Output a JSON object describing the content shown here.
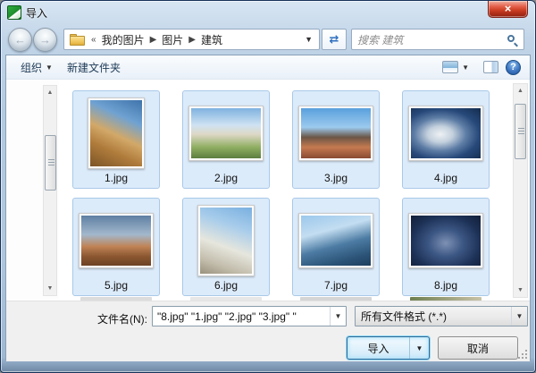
{
  "window": {
    "title": "导入"
  },
  "colors": {
    "selection_fill": "#dcebfa",
    "selection_border": "#a9c8e8",
    "close_button": "#c93b22",
    "default_button_glow": "#8fd8f4"
  },
  "icons": {
    "close": "×",
    "back": "←",
    "forward": "→",
    "refresh": "⇄",
    "dropdown": "▼",
    "breadcrumb_sep": "▶",
    "overflow": "«",
    "scroll_up": "▲",
    "scroll_down": "▼",
    "help": "?"
  },
  "navbar": {
    "breadcrumb": {
      "items": [
        "我的图片",
        "图片",
        "建筑"
      ]
    },
    "search": {
      "placeholder": "搜索 建筑"
    }
  },
  "toolbar": {
    "organize_label": "组织",
    "new_folder_label": "新建文件夹"
  },
  "files": [
    {
      "label": "1.jpg"
    },
    {
      "label": "2.jpg"
    },
    {
      "label": "3.jpg"
    },
    {
      "label": "4.jpg"
    },
    {
      "label": "5.jpg"
    },
    {
      "label": "6.jpg"
    },
    {
      "label": "7.jpg"
    },
    {
      "label": "8.jpg"
    }
  ],
  "footer": {
    "filename_label": "文件名(N):",
    "filename_value": "\"8.jpg\" \"1.jpg\" \"2.jpg\" \"3.jpg\" \"",
    "filetype_value": "所有文件格式 (*.*)",
    "import_label": "导入",
    "cancel_label": "取消"
  }
}
